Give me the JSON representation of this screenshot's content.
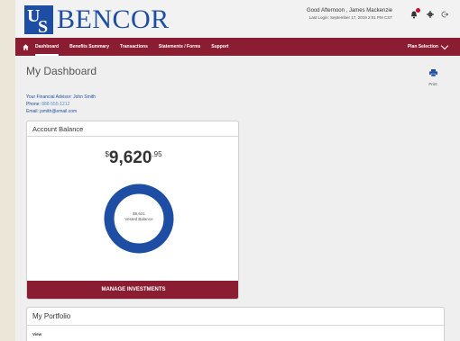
{
  "header": {
    "logo_box_u": "U",
    "logo_box_s": "S",
    "logo_text": "BENCOR",
    "greeting": "Good Afternoon , James Mackenzie",
    "last_login": "Last Login: September 17, 2019 2:01 PM CST",
    "icons": [
      "bell-icon",
      "gear-icon",
      "logout-icon"
    ]
  },
  "nav": {
    "items": [
      "Dashboard",
      "Benefits Summary",
      "Transactions",
      "Statements / Forms",
      "Support"
    ],
    "plan_selection": "Plan Selection"
  },
  "page": {
    "title": "My Dashboard",
    "print_label": "Print"
  },
  "advisor": {
    "name_line": "Your Financial Advisor: John Smith",
    "phone_label": "Phone:",
    "phone": "888-555-1212",
    "email_line": "Email: jsmith@email.com"
  },
  "balance": {
    "header": "Account Balance",
    "currency": "$",
    "whole": "9,620",
    "cents": ".95",
    "donut_value": "$9,621",
    "donut_label": "Vested Balance",
    "vested_fraction": 1.0,
    "button": "MANAGE INVESTMENTS"
  },
  "portfolio": {
    "header": "My Portfolio",
    "view_label": "View"
  },
  "colors": {
    "brand_blue": "#1e4ea3",
    "nav_maroon": "#8a1d31",
    "alert_red": "#c8102e"
  }
}
